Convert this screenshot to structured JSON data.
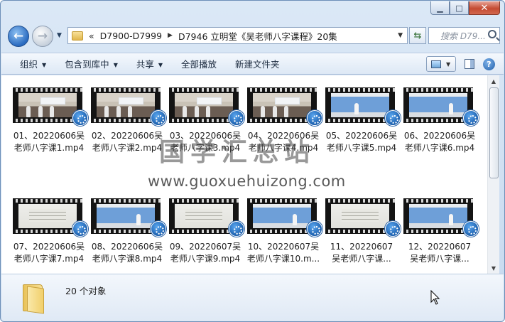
{
  "window": {
    "minimize_glyph": "▁",
    "maximize_glyph": "□",
    "close_glyph": "✕"
  },
  "nav": {
    "back_glyph": "←",
    "forward_glyph": "→",
    "breadcrumb": [
      "«",
      "D7900-D7999",
      "D7946 立明堂《吴老师八字课程》20集"
    ],
    "search_placeholder": "搜索 D79..."
  },
  "toolbar": {
    "organize": "组织",
    "include_library": "包含到库中",
    "share": "共享",
    "play_all": "全部播放",
    "new_folder": "新建文件夹"
  },
  "files": [
    {
      "line1": "01、20220606吴",
      "line2": "老师八字课1.mp4",
      "scene": "room"
    },
    {
      "line1": "02、20220606吴",
      "line2": "老师八字课2.mp4",
      "scene": "room"
    },
    {
      "line1": "03、20220606吴",
      "line2": "老师八字课3.mp4",
      "scene": "room"
    },
    {
      "line1": "04、20220606吴",
      "line2": "老师八字课4.mp4",
      "scene": "room"
    },
    {
      "line1": "05、20220606吴",
      "line2": "老师八字课5.mp4",
      "scene": "board"
    },
    {
      "line1": "06、20220606吴",
      "line2": "老师八字课6.mp4",
      "scene": "board"
    },
    {
      "line1": "07、20220606吴",
      "line2": "老师八字课7.mp4",
      "scene": "slide"
    },
    {
      "line1": "08、20220606吴",
      "line2": "老师八字课8.mp4",
      "scene": "board"
    },
    {
      "line1": "09、20220607吴",
      "line2": "老师八字课9.mp4",
      "scene": "slide"
    },
    {
      "line1": "10、20220607吴",
      "line2": "老师八字课10.m...",
      "scene": "board"
    },
    {
      "line1": "11、20220607",
      "line2": "吴老师八字课...",
      "scene": "slide"
    },
    {
      "line1": "12、20220607",
      "line2": "吴老师八字课...",
      "scene": "board"
    }
  ],
  "status": {
    "count_text": "20 个对象"
  },
  "watermark": {
    "cn": "国学汇总站",
    "url": "www.guoxuehuizong.com"
  }
}
